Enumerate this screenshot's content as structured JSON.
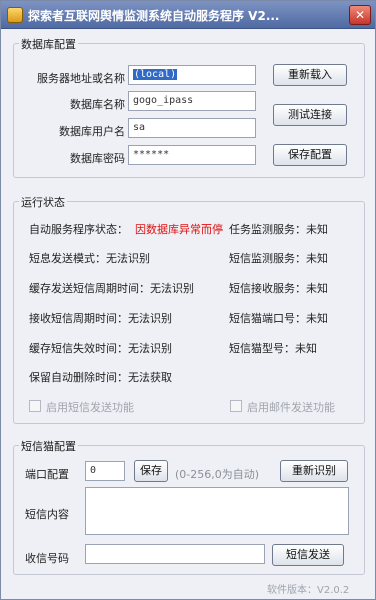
{
  "window": {
    "title": "探索者互联网舆情监测系统自动服务程序 V2...",
    "close_glyph": "✕"
  },
  "db_config": {
    "group_title": "数据库配置",
    "server_label": "服务器地址或名称",
    "server_value": "(local)",
    "dbname_label": "数据库名称",
    "dbname_value": "gogo_ipass",
    "user_label": "数据库用户名",
    "user_value": "sa",
    "password_label": "数据库密码",
    "password_value": "******",
    "reload_button": "重新载入",
    "test_button": "测试连接",
    "save_button": "保存配置"
  },
  "run_status": {
    "group_title": "运行状态",
    "auto_service_label": "自动服务程序状态：",
    "auto_service_value": "因数据库异常而停",
    "task_monitor": "任务监测服务：未知",
    "sms_mode": "短息发送模式：无法识别",
    "sms_monitor": "短信监测服务：未知",
    "cache_sms_cycle": "缓存发送短信周期时间：无法识别",
    "sms_receive": "短信接收服务：未知",
    "recv_sms_cycle": "接收短信周期时间：无法识别",
    "sms_port": "短信猫端口号：未知",
    "cache_sms_expire": "缓存短信失效时间：无法识别",
    "sms_model": "短信猫型号：未知",
    "keep_auto_delete": "保留自动删除时间：无法获取",
    "enable_sms": "启用短信发送功能",
    "enable_mail": "启用邮件发送功能"
  },
  "sms_config": {
    "group_title": "短信猫配置",
    "port_label": "端口配置",
    "port_value": "0",
    "save_button": "保存",
    "port_hint": "(0-256,0为自动)",
    "reidentify_button": "重新识别",
    "content_label": "短信内容",
    "content_value": "",
    "number_label": "收信号码",
    "number_value": "",
    "send_button": "短信发送"
  },
  "footer": {
    "version": "软件版本：V2.0.2"
  }
}
